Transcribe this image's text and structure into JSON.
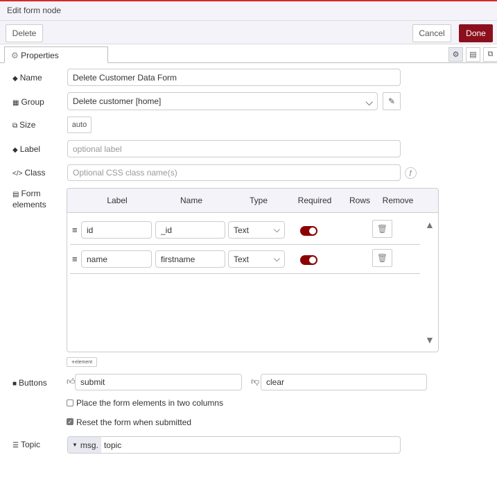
{
  "title": "Edit form node",
  "toolbar": {
    "delete": "Delete",
    "cancel": "Cancel",
    "done": "Done"
  },
  "tabs": {
    "properties": "Properties"
  },
  "fields": {
    "name_label": "Name",
    "name_value": "Delete Customer Data Form",
    "group_label": "Group",
    "group_value": "Delete customer [home]",
    "size_label": "Size",
    "size_value": "auto",
    "label_label": "Label",
    "label_placeholder": "optional label",
    "class_label": "Class",
    "class_placeholder": "Optional CSS class name(s)",
    "form_label1": "Form",
    "form_label2": "elements"
  },
  "table": {
    "headers": [
      "Label",
      "Name",
      "Type",
      "Required",
      "Rows",
      "Remove"
    ],
    "rows": [
      {
        "label": "id",
        "name": "_id",
        "type": "Text",
        "required": true
      },
      {
        "label": "name",
        "name": "firstname",
        "type": "Text",
        "required": true
      }
    ],
    "add_button": "element"
  },
  "buttons": {
    "label": "Buttons",
    "submit": "submit",
    "clear": "clear"
  },
  "options": {
    "two_columns": "Place the form elements in two columns",
    "two_columns_checked": false,
    "reset": "Reset the form when submitted",
    "reset_checked": true
  },
  "topic": {
    "label": "Topic",
    "prefix": "msg.",
    "value": "topic"
  },
  "colors": {
    "accent": "#8c101c",
    "toggle": "#8b0000"
  }
}
